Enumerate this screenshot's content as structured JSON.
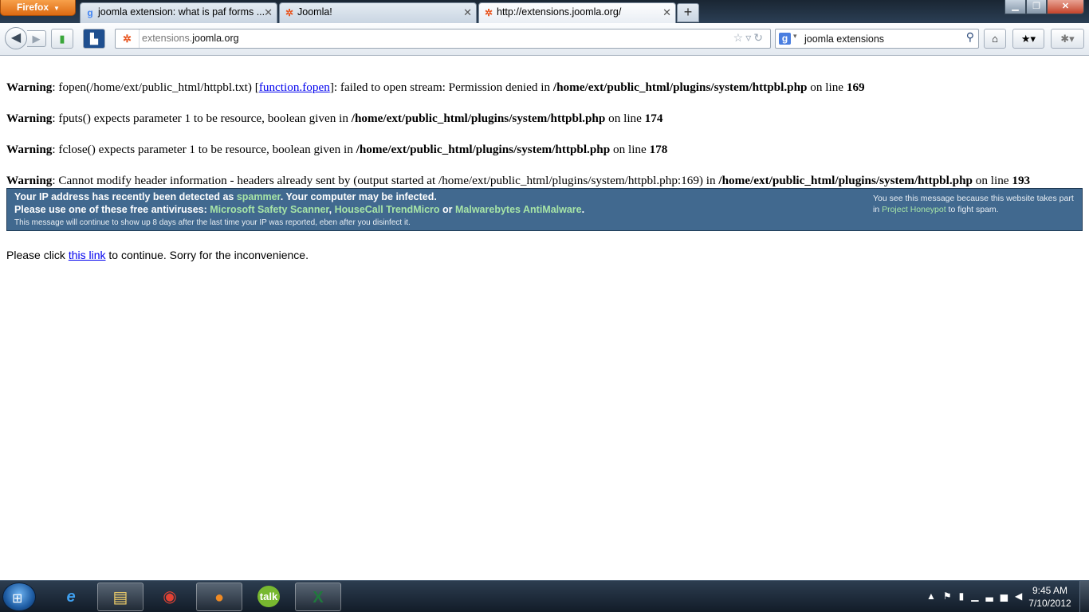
{
  "browser": {
    "menu_button": "Firefox",
    "tabs": [
      {
        "title": "joomla extension: what is paf forms ...",
        "icon": "google-icon",
        "active": false
      },
      {
        "title": "Joomla!",
        "icon": "joomla-icon",
        "active": false
      },
      {
        "title": "http://extensions.joomla.org/",
        "icon": "joomla-icon",
        "active": true
      }
    ],
    "url_prefix": "extensions.",
    "url_domain": "joomla.org",
    "search_text": "joomla extensions"
  },
  "page": {
    "warnings": [
      {
        "label": "Warning",
        "text1": ": fopen(/home/ext/public_html/httpbl.txt) [",
        "link": "function.fopen",
        "text2": "]: failed to open stream: Permission denied in ",
        "file": "/home/ext/public_html/plugins/system/httpbl.php",
        "text3": " on line ",
        "line": "169"
      },
      {
        "label": "Warning",
        "text1": ": fputs() expects parameter 1 to be resource, boolean given in ",
        "file": "/home/ext/public_html/plugins/system/httpbl.php",
        "text3": " on line ",
        "line": "174"
      },
      {
        "label": "Warning",
        "text1": ": fclose() expects parameter 1 to be resource, boolean given in ",
        "file": "/home/ext/public_html/plugins/system/httpbl.php",
        "text3": " on line ",
        "line": "178"
      },
      {
        "label": "Warning",
        "text1": ": Cannot modify header information - headers already sent by (output started at /home/ext/public_html/plugins/system/httpbl.php:169) in ",
        "file": "/home/ext/public_html/plugins/system/httpbl.php",
        "text3": " on line ",
        "line": "193"
      }
    ],
    "honeypot": {
      "line1_a": "Your IP address has recently been detected as ",
      "line1_b": "spammer",
      "line1_c": ". Your computer may be infected.",
      "line2_a": "Please use one of these free antiviruses: ",
      "av1": "Microsoft Safety Scanner",
      "sep1": ", ",
      "av2": "HouseCall TrendMicro",
      "sep2": " or ",
      "av3": "Malwarebytes AntiMalware",
      "end": ".",
      "line3": "This message will continue to show up 8 days after the last time your IP was reported, eben after you disinfect it.",
      "right_a": "You see this message because this website takes part in ",
      "right_link": "Project Honeypot",
      "right_b": " to fight spam."
    },
    "continue_a": "Please click ",
    "continue_link": "this link",
    "continue_b": " to continue. Sorry for the inconvenience."
  },
  "taskbar": {
    "time": "9:45 AM",
    "date": "7/10/2012",
    "apps": [
      "explorer-icon",
      "internet-explorer-icon",
      "file-explorer-icon",
      "chrome-icon",
      "firefox-icon",
      "google-talk-icon",
      "excel-icon"
    ]
  }
}
